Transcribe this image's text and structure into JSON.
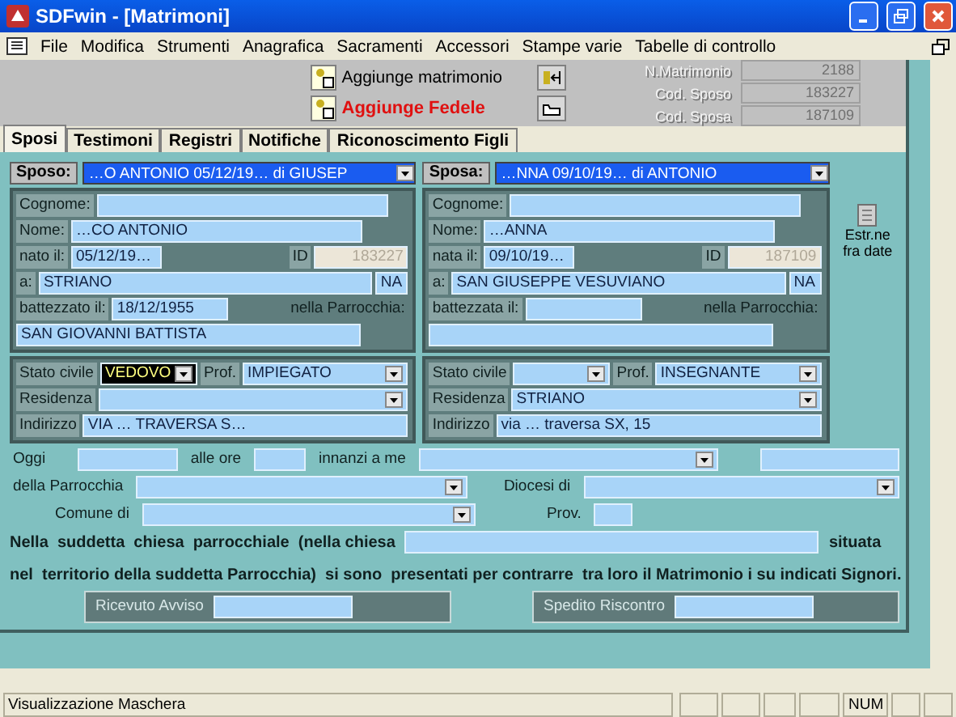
{
  "window": {
    "title": "SDFwin - [Matrimoni]"
  },
  "menu": [
    "File",
    "Modifica",
    "Strumenti",
    "Anagrafica",
    "Sacramenti",
    "Accessori",
    "Stampe varie",
    "Tabelle di controllo"
  ],
  "toolbar": {
    "buttons": [
      {
        "label": "Aggiunge matrimonio",
        "kind": "normal"
      },
      {
        "label": "Aggiunge Fedele",
        "kind": "alert"
      }
    ],
    "codes": [
      {
        "label": "N.Matrimonio",
        "value": "2188"
      },
      {
        "label": "Cod. Sposo",
        "value": "183227"
      },
      {
        "label": "Cod. Sposa",
        "value": "187109"
      }
    ]
  },
  "tabs": [
    {
      "label": "Sposi",
      "selected": true
    },
    {
      "label": "Testimoni",
      "selected": false
    },
    {
      "label": "Registri",
      "selected": false
    },
    {
      "label": "Notifiche",
      "selected": false
    },
    {
      "label": "Riconoscimento Figli",
      "selected": false
    }
  ],
  "spouses": [
    {
      "selector_label": "Sposo:",
      "selector_value": "…O ANTONIO 05/12/19… di GIUSEP",
      "cognome_label": "Cognome:",
      "nome_label": "Nome:",
      "nome_value": "…CO ANTONIO",
      "nato_label": "nato il:",
      "nato_value": "05/12/19…",
      "id_label": "ID",
      "id_value": "183227",
      "a_label": "a:",
      "a_value": "STRIANO",
      "prov": "NA",
      "battezzato_label": "battezzato il:",
      "battezzato_value": "18/12/1955",
      "parrocchia_label": "nella Parrocchia:",
      "parrocchia_value": "SAN GIOVANNI BATTISTA",
      "stato_label": "Stato civile",
      "stato_value": "VEDOVO",
      "stato_focused": true,
      "prof_label": "Prof.",
      "prof_value": "IMPIEGATO",
      "residenza_label": "Residenza",
      "indirizzo_label": "Indirizzo",
      "indirizzo_value": "VIA … TRAVERSA S…"
    },
    {
      "selector_label": "Sposa:",
      "selector_value": "…NNA 09/10/19… di ANTONIO",
      "cognome_label": "Cognome:",
      "nome_label": "Nome:",
      "nome_value": "…ANNA",
      "nato_label": "nata il:",
      "nato_value": "09/10/19…",
      "id_label": "ID",
      "id_value": "187109",
      "a_label": "a:",
      "a_value": "SAN GIUSEPPE VESUVIANO",
      "prov": "NA",
      "battezzato_label": "battezzata il:",
      "parrocchia_label": "nella Parrocchia:",
      "stato_label": "Stato civile",
      "stato_focused": false,
      "prof_label": "Prof.",
      "prof_value": "INSEGNANTE",
      "residenza_label": "Residenza",
      "residenza_value": "STRIANO",
      "indirizzo_label": "Indirizzo",
      "indirizzo_value": "via … traversa SX, 15"
    }
  ],
  "estr": "Estr.ne fra date",
  "form": {
    "oggi": "Oggi",
    "alle_ore": "alle ore",
    "innanzi": "innanzi a me",
    "parrocchia": "della Parrocchia",
    "diocesi": "Diocesi di",
    "comune": "Comune di",
    "prov": "Prov.",
    "sentence1": "Nella  suddetta  chiesa  parrocchiale  (nella chiesa",
    "situata": "situata",
    "sentence2": "nel  territorio della suddetta Parrocchia)  si sono  presentati per contrarre  tra loro il Matrimonio i su indicati Signori.",
    "avviso": "Ricevuto Avviso",
    "riscontro": "Spedito Riscontro"
  },
  "status_bar": {
    "text": "Visualizzazione Maschera",
    "num": "NUM"
  }
}
